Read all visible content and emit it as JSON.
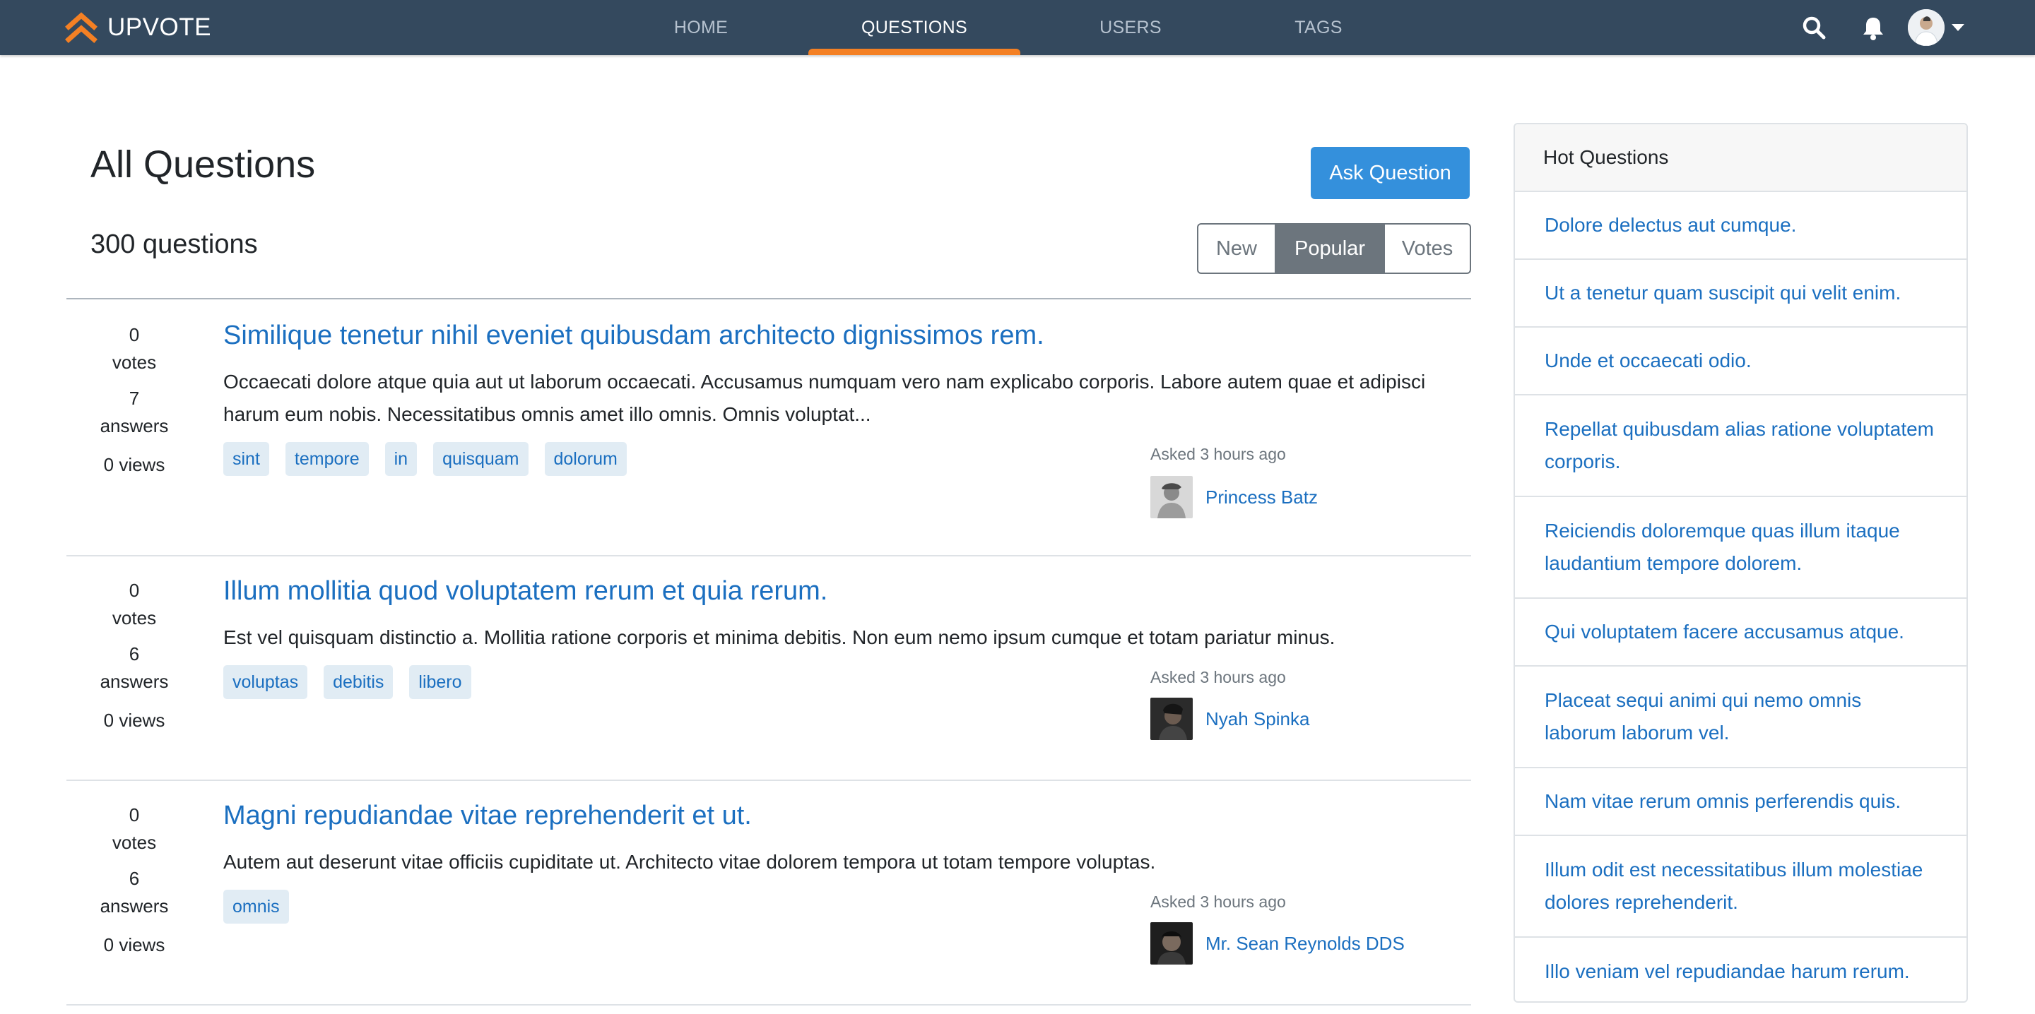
{
  "brand": {
    "name": "UPVOTE"
  },
  "nav": {
    "home": "HOME",
    "questions": "QUESTIONS",
    "users": "USERS",
    "tags": "TAGS"
  },
  "page": {
    "title": "All Questions",
    "ask_button": "Ask Question",
    "count": "300 questions",
    "filters": {
      "new": "New",
      "popular": "Popular",
      "votes": "Votes",
      "active": "Popular"
    }
  },
  "questions": [
    {
      "votes": "0",
      "votes_label": "votes",
      "answers": "7",
      "answers_label": "answers",
      "views": "0 views",
      "title": "Similique tenetur nihil eveniet quibusdam architecto dignissimos rem.",
      "excerpt": "Occaecati dolore atque quia aut ut laborum occaecati. Accusamus numquam vero nam explicabo corporis. Labore autem quae et adipisci harum eum nobis. Necessitatibus omnis amet illo omnis. Omnis voluptat...",
      "tags": [
        "sint",
        "tempore",
        "in",
        "quisquam",
        "dolorum"
      ],
      "asked": "Asked 3 hours ago",
      "user": "Princess Batz"
    },
    {
      "votes": "0",
      "votes_label": "votes",
      "answers": "6",
      "answers_label": "answers",
      "views": "0 views",
      "title": "Illum mollitia quod voluptatem rerum et quia rerum.",
      "excerpt": "Est vel quisquam distinctio a. Mollitia ratione corporis et minima debitis. Non eum nemo ipsum cumque et totam pariatur minus.",
      "tags": [
        "voluptas",
        "debitis",
        "libero"
      ],
      "asked": "Asked 3 hours ago",
      "user": "Nyah Spinka"
    },
    {
      "votes": "0",
      "votes_label": "votes",
      "answers": "6",
      "answers_label": "answers",
      "views": "0 views",
      "title": "Magni repudiandae vitae reprehenderit et ut.",
      "excerpt": "Autem aut deserunt vitae officiis cupiditate ut. Architecto vitae dolorem tempora ut totam tempore voluptas.",
      "tags": [
        "omnis"
      ],
      "asked": "Asked 3 hours ago",
      "user": "Mr. Sean Reynolds DDS"
    }
  ],
  "hot": {
    "header": "Hot Questions",
    "items": [
      "Dolore delectus aut cumque.",
      "Ut a tenetur quam suscipit qui velit enim.",
      "Unde et occaecati odio.",
      "Repellat quibusdam alias ratione voluptatem corporis.",
      "Reiciendis doloremque quas illum itaque laudantium tempore dolorem.",
      "Qui voluptatem facere accusamus atque.",
      "Placeat sequi animi qui nemo omnis laborum laborum vel.",
      "Nam vitae rerum omnis perferendis quis.",
      "Illum odit est necessitatibus illum molestiae dolores reprehenderit.",
      "Illo veniam vel repudiandae harum rerum."
    ]
  },
  "colors": {
    "navbar": "#34495e",
    "accent": "#f48024",
    "primary": "#3490dc",
    "link": "#1b6fc0",
    "tag_bg": "#e1ecf4"
  },
  "icons": {
    "logo": "double-chevron-up-icon",
    "search": "search-icon",
    "notifications": "bell-icon",
    "dropdown": "caret-down-icon"
  }
}
